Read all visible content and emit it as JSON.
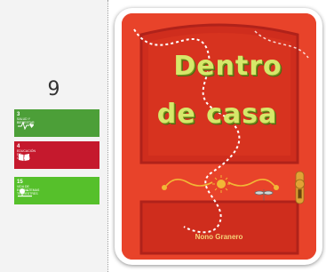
{
  "count": "9",
  "sdg_badges": [
    {
      "number": "3",
      "text": "Salud y bienestar",
      "color": "#4c9f38",
      "icon": "heartbeat-icon"
    },
    {
      "number": "4",
      "text": "Educación de calidad",
      "color": "#c5192d",
      "icon": "book-icon"
    },
    {
      "number": "15",
      "text": "Vida de ecosistemas terrestres",
      "color": "#56c02b",
      "icon": "tree-bird-icon"
    }
  ],
  "book": {
    "title_line1": "Dentro",
    "title_line2": "de casa",
    "author": "Nono Granero",
    "cover_color": "#e63a22"
  }
}
